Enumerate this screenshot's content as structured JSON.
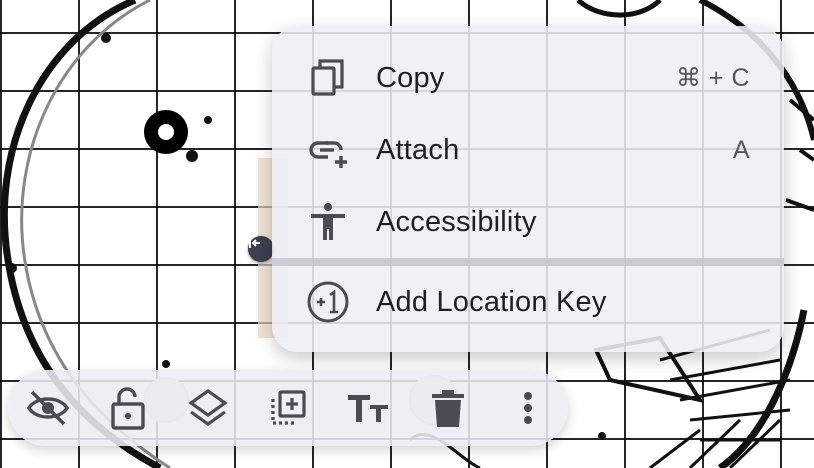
{
  "context_menu": {
    "items": [
      {
        "label": "Copy",
        "shortcut": "⌘ + C",
        "icon": "copy-icon"
      },
      {
        "label": "Attach",
        "shortcut": "A",
        "icon": "attach-link-icon"
      },
      {
        "label": "Accessibility",
        "shortcut": "",
        "icon": "accessibility-icon"
      },
      {
        "label": "Add Location Key",
        "shortcut": "",
        "icon": "location-key-icon"
      }
    ]
  },
  "toolbar": {
    "buttons": [
      {
        "name": "hide",
        "icon": "eye-off-icon"
      },
      {
        "name": "unlock",
        "icon": "lock-open-icon"
      },
      {
        "name": "layers",
        "icon": "layers-icon"
      },
      {
        "name": "duplicate",
        "icon": "duplicate-icon"
      },
      {
        "name": "text-size",
        "icon": "text-size-icon"
      },
      {
        "name": "delete",
        "icon": "trash-icon"
      },
      {
        "name": "more",
        "icon": "more-vertical-icon"
      }
    ]
  },
  "colors": {
    "menu_background": "#eeeff6",
    "text": "#1f1f23",
    "icon": "#4a4b53",
    "shortcut": "#55565e",
    "handle": "#3c3f4e"
  }
}
